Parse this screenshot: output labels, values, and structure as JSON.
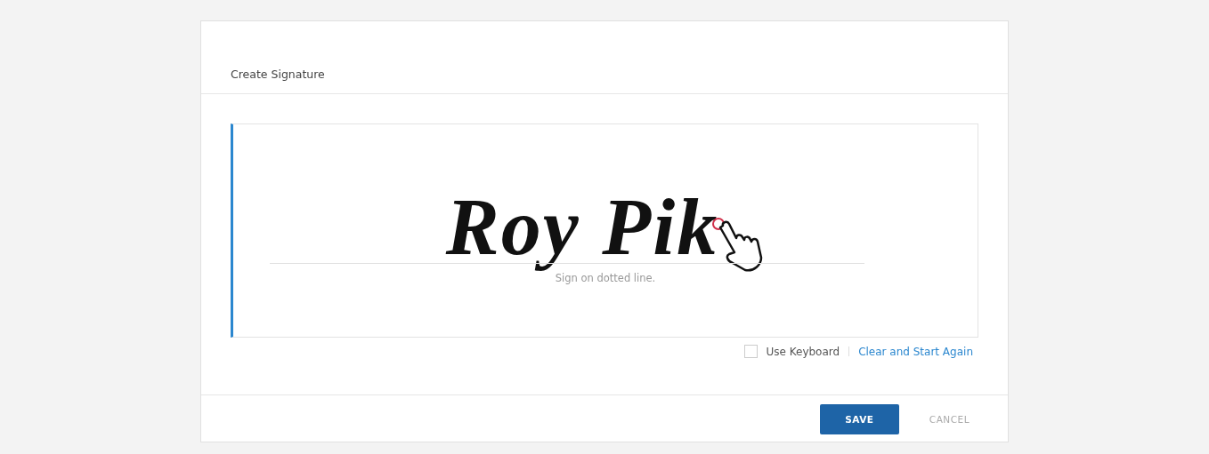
{
  "dialog": {
    "title": "Create Signature",
    "pad": {
      "signature": "Roy Pik",
      "hint": "Sign on dotted line."
    },
    "options": {
      "use_keyboard": {
        "label": "Use Keyboard",
        "checked": false
      },
      "clear_link": "Clear and Start Again"
    },
    "buttons": [
      {
        "kind": "primary",
        "label": "SAVE"
      },
      {
        "kind": "secondary",
        "label": "CANCEL"
      }
    ]
  }
}
